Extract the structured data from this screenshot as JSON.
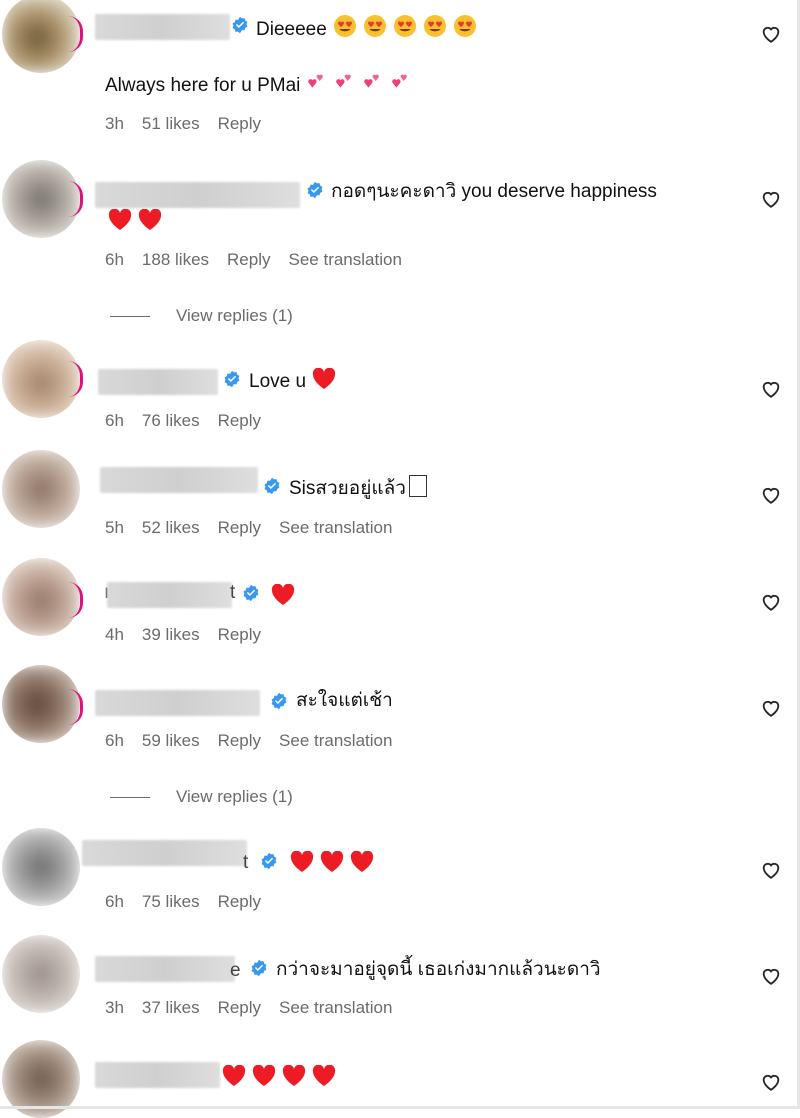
{
  "colors": {
    "meta": "#6b6b6b",
    "verified": "#3897f0",
    "heart_red": "#ed1c24",
    "ring": "#e0117a"
  },
  "comments": [
    {
      "text": "Dieeeee",
      "text2": "Always here for u PMai",
      "time": "3h",
      "likes": "51 likes",
      "reply": "Reply"
    },
    {
      "text": "กอดๆนะคะดาวิ you deserve happiness",
      "time": "6h",
      "likes": "188 likes",
      "reply": "Reply",
      "translate": "See translation",
      "view_replies": "View replies (1)"
    },
    {
      "text": "Love u",
      "time": "6h",
      "likes": "76 likes",
      "reply": "Reply"
    },
    {
      "text": "Sisสวยอยู่แล้ว",
      "time": "5h",
      "likes": "52 likes",
      "reply": "Reply",
      "translate": "See translation"
    },
    {
      "name_fragment_left": "ı",
      "name_fragment_right": "t",
      "time": "4h",
      "likes": "39 likes",
      "reply": "Reply"
    },
    {
      "text": "สะใจแต่เช้า",
      "time": "6h",
      "likes": "59 likes",
      "reply": "Reply",
      "translate": "See translation",
      "view_replies": "View replies (1)"
    },
    {
      "name_fragment": "t",
      "time": "6h",
      "likes": "75 likes",
      "reply": "Reply"
    },
    {
      "name_fragment": "e",
      "text": "กว่าจะมาอยู่จุดนี้ เธอเก่งมากแล้วนะดาวิ",
      "time": "3h",
      "likes": "37 likes",
      "reply": "Reply",
      "translate": "See translation"
    },
    {}
  ]
}
